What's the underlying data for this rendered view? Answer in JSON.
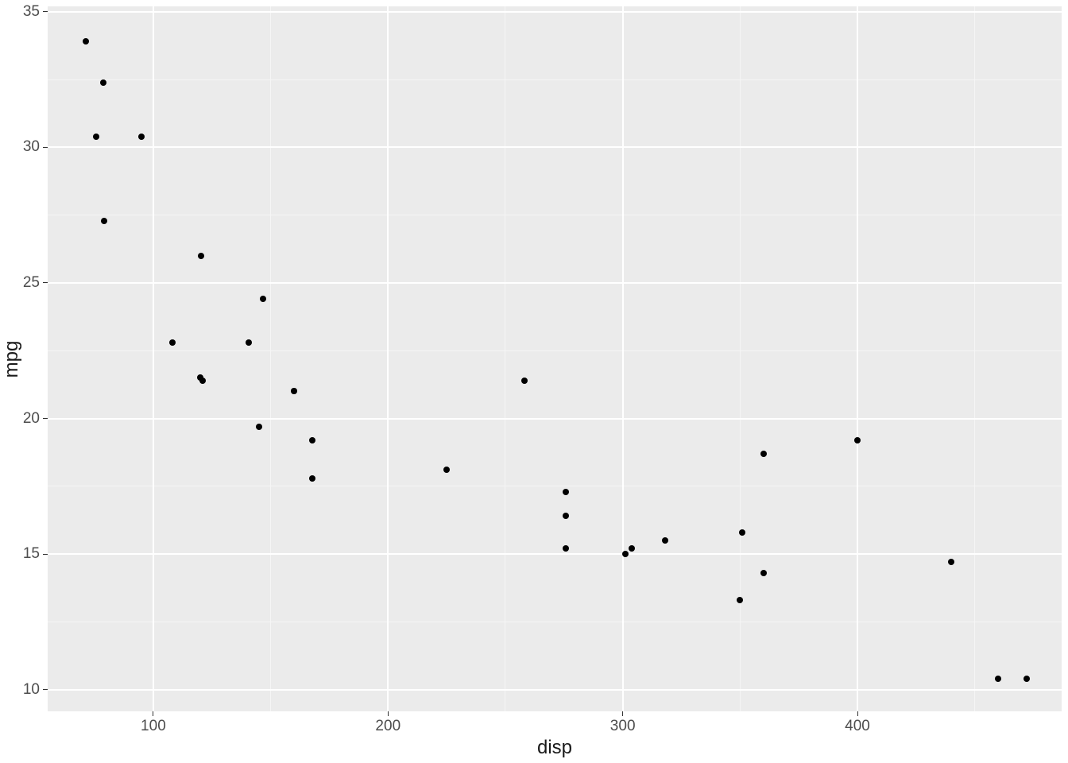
{
  "chart_data": {
    "type": "scatter",
    "title": "",
    "xlabel": "disp",
    "ylabel": "mpg",
    "xlim": [
      55,
      487
    ],
    "ylim": [
      9.2,
      35.2
    ],
    "x_ticks": [
      100,
      200,
      300,
      400
    ],
    "y_ticks": [
      10,
      15,
      20,
      25,
      30,
      35
    ],
    "x_minor": [
      150,
      250,
      350,
      450
    ],
    "y_minor": [
      12.5,
      17.5,
      22.5,
      27.5,
      32.5
    ],
    "points": [
      {
        "x": 160.0,
        "y": 21.0
      },
      {
        "x": 160.0,
        "y": 21.0
      },
      {
        "x": 108.0,
        "y": 22.8
      },
      {
        "x": 258.0,
        "y": 21.4
      },
      {
        "x": 360.0,
        "y": 18.7
      },
      {
        "x": 225.0,
        "y": 18.1
      },
      {
        "x": 360.0,
        "y": 14.3
      },
      {
        "x": 146.7,
        "y": 24.4
      },
      {
        "x": 140.8,
        "y": 22.8
      },
      {
        "x": 167.6,
        "y": 19.2
      },
      {
        "x": 167.6,
        "y": 17.8
      },
      {
        "x": 275.8,
        "y": 16.4
      },
      {
        "x": 275.8,
        "y": 17.3
      },
      {
        "x": 275.8,
        "y": 15.2
      },
      {
        "x": 472.0,
        "y": 10.4
      },
      {
        "x": 460.0,
        "y": 10.4
      },
      {
        "x": 440.0,
        "y": 14.7
      },
      {
        "x": 78.7,
        "y": 32.4
      },
      {
        "x": 75.7,
        "y": 30.4
      },
      {
        "x": 71.1,
        "y": 33.9
      },
      {
        "x": 120.1,
        "y": 21.5
      },
      {
        "x": 318.0,
        "y": 15.5
      },
      {
        "x": 304.0,
        "y": 15.2
      },
      {
        "x": 350.0,
        "y": 13.3
      },
      {
        "x": 400.0,
        "y": 19.2
      },
      {
        "x": 79.0,
        "y": 27.3
      },
      {
        "x": 120.3,
        "y": 26.0
      },
      {
        "x": 95.1,
        "y": 30.4
      },
      {
        "x": 351.0,
        "y": 15.8
      },
      {
        "x": 145.0,
        "y": 19.7
      },
      {
        "x": 301.0,
        "y": 15.0
      },
      {
        "x": 121.0,
        "y": 21.4
      }
    ]
  }
}
